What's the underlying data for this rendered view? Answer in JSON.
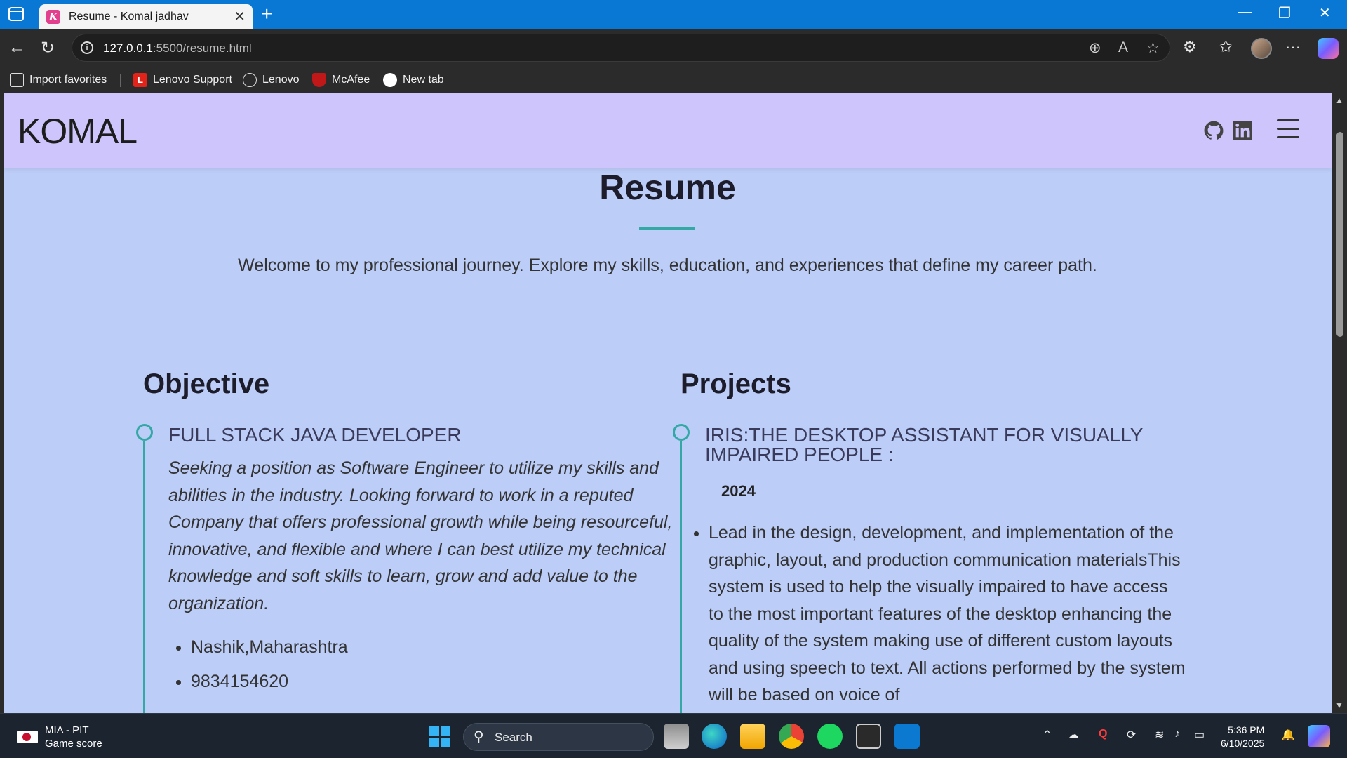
{
  "browser": {
    "tab_title": "Resume - Komal jadhav",
    "tab_favicon_letter": "K",
    "url_host": "127.0.0.1",
    "url_path": ":5500/resume.html",
    "bookmarks": [
      {
        "label": "Import favorites",
        "icon": "import-icon"
      },
      {
        "label": "Lenovo Support",
        "icon": "lenovo-l-icon",
        "badge": "L",
        "color": "#e2231a"
      },
      {
        "label": "Lenovo",
        "icon": "globe-icon"
      },
      {
        "label": "McAfee",
        "icon": "mcafee-shield-icon",
        "color": "#c01818"
      },
      {
        "label": "New tab",
        "icon": "circle-icon"
      }
    ]
  },
  "site": {
    "logo": "KOMAL",
    "nav_icons": [
      "github-icon",
      "linkedin-icon",
      "hamburger-menu-icon"
    ]
  },
  "page": {
    "title": "Resume",
    "intro": "Welcome to my professional journey. Explore my skills, education, and experiences that define my career path.",
    "objective": {
      "heading": "Objective",
      "item_title": "FULL STACK JAVA DEVELOPER",
      "text": "Seeking a position as Software Engineer to utilize my skills and abilities in the industry. Looking forward to work in a reputed Company that offers professional growth while being resourceful, innovative, and flexible and where I can best utilize my technical knowledge and soft skills to learn, grow and add value to the organization.",
      "bullets": [
        "Nashik,Maharashtra",
        "9834154620"
      ]
    },
    "projects": {
      "heading": "Projects",
      "item_title_line1": "IRIS:THE DESKTOP ASSISTANT FOR VISUALLY",
      "item_title_line2": "IMPAIRED PEOPLE :",
      "year": "2024",
      "description": "Lead in the design, development, and implementation of the graphic, layout, and production communication materialsThis system is used to help the visually impaired to have access to the most important features of the desktop enhancing the quality of the system making use of different custom layouts and using speech to text. All actions performed by the system will be based on voice of"
    },
    "accent_color": "#33a8a4",
    "background_color": "#bccdf8",
    "nav_color": "#cdc5fb"
  },
  "taskbar": {
    "widget_title": "MIA - PIT",
    "widget_subtitle": "Game score",
    "search_label": "Search",
    "time": "5:36 PM",
    "date": "6/10/2025"
  }
}
